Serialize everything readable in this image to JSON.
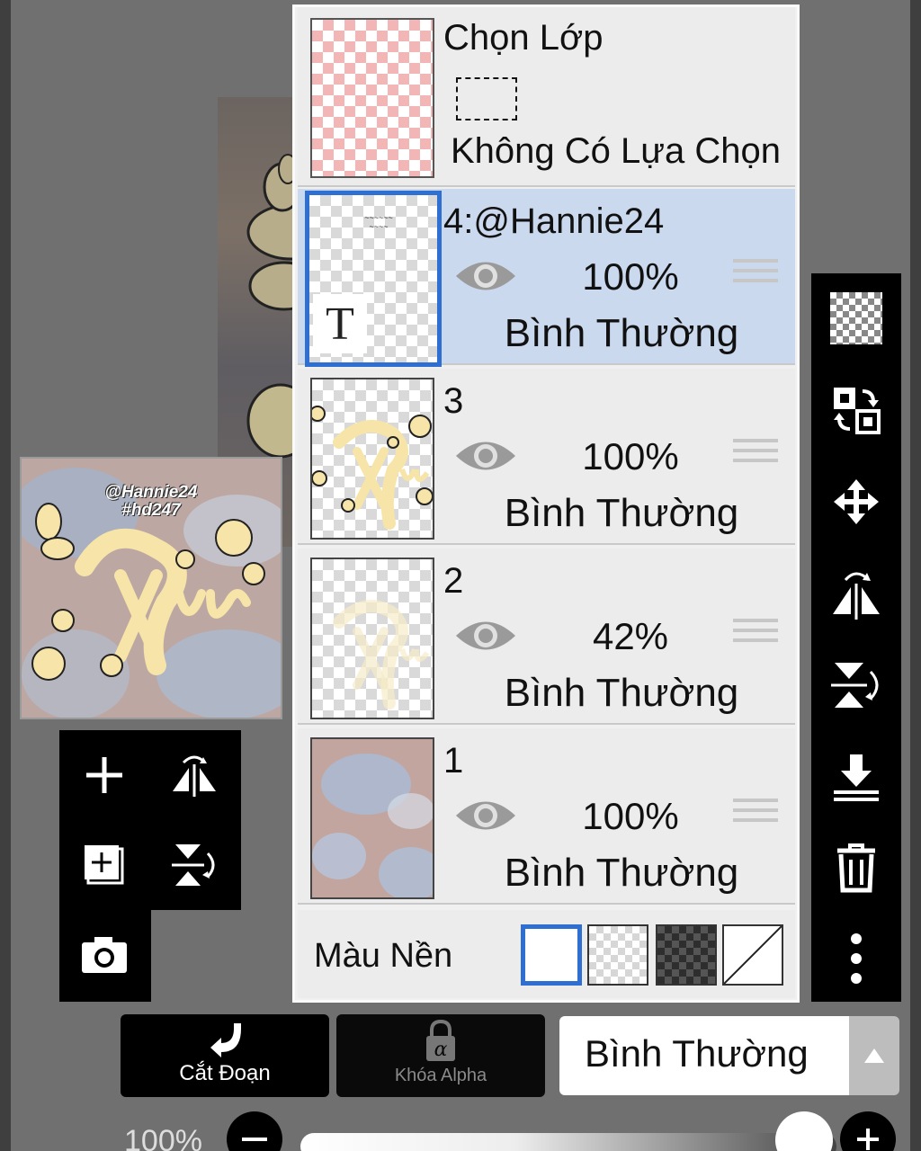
{
  "layers_panel": {
    "selection": {
      "title": "Chọn Lớp",
      "status": "Không Có Lựa Chọn"
    },
    "layers": [
      {
        "name": "4:@Hannie24",
        "opacity": "100%",
        "blend": "Bình Thường",
        "selected": true,
        "type_badge": "T"
      },
      {
        "name": "3",
        "opacity": "100%",
        "blend": "Bình Thường",
        "selected": false
      },
      {
        "name": "2",
        "opacity": "42%",
        "blend": "Bình Thường",
        "selected": false
      },
      {
        "name": "1",
        "opacity": "100%",
        "blend": "Bình Thường",
        "selected": false
      }
    ],
    "background": {
      "label": "Màu Nền",
      "selected_swatch": "white"
    }
  },
  "preview": {
    "watermark_line1": "@Hannie24",
    "watermark_line2": "#hd247"
  },
  "bottom_bar": {
    "clip_label": "Cắt Đoạn",
    "alpha_lock_label": "Khóa Alpha",
    "blend_mode": "Bình Thường",
    "opacity": "100%"
  },
  "colors": {
    "accent": "#2f6fd1",
    "selected_row": "#cbd9ee",
    "panel_bg": "#ececec",
    "toolbar_bg": "#000000",
    "canvas_bg": "#707070"
  },
  "icons": {
    "right_bar": [
      "transparency-icon",
      "swap-layers-icon",
      "move-icon",
      "flip-horizontal-icon",
      "flip-vertical-icon",
      "merge-down-icon",
      "trash-icon",
      "more-options-icon"
    ],
    "left_tools": [
      "add-layer-icon",
      "flip-horizontal-icon",
      "add-copy-icon",
      "flip-vertical-icon",
      "camera-icon"
    ]
  }
}
